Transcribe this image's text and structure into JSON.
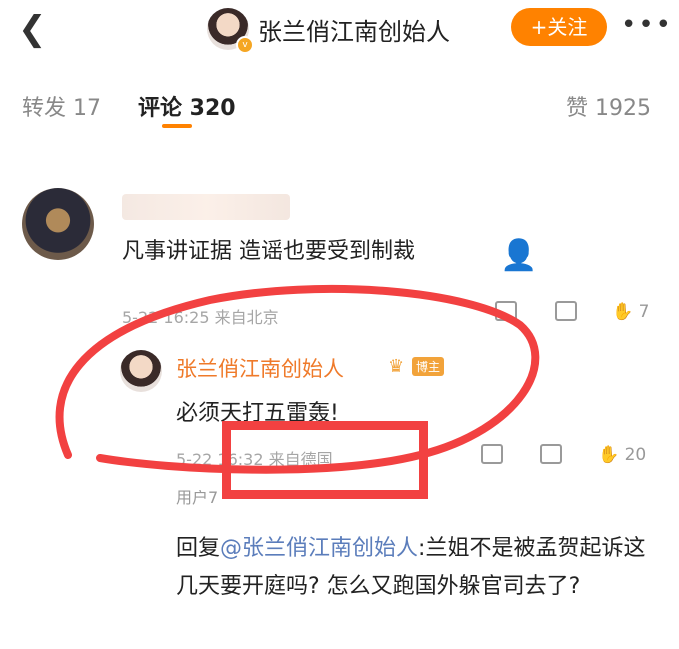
{
  "header": {
    "back_icon": "chevron-left-icon",
    "title": "张兰俏江南创始人",
    "follow_label": "+关注",
    "more_label": "•••"
  },
  "tabs": [
    {
      "label": "转发 17"
    },
    {
      "label": "评论 320"
    },
    {
      "label": "赞 1925"
    }
  ],
  "comments": [
    {
      "text": "凡事讲证据 造谣也要受到制裁",
      "time": "5-22 16:25",
      "location": "来自北京",
      "likes": "7"
    },
    {
      "author": "张兰俏江南创始人",
      "badge": "博主",
      "text": "必须天打五雷轰!",
      "time": "5-22 16:32",
      "location": "来自德国",
      "likes": "20"
    },
    {
      "author": "用户7",
      "reply_prefix": "回复",
      "mention": "@张兰俏江南创始人",
      "text": ":兰姐不是被孟贺起诉这几天要开庭吗? 怎么又跑国外躲官司去了?"
    }
  ],
  "colors": {
    "accent": "#ff8200",
    "annotation": "#f24141"
  }
}
